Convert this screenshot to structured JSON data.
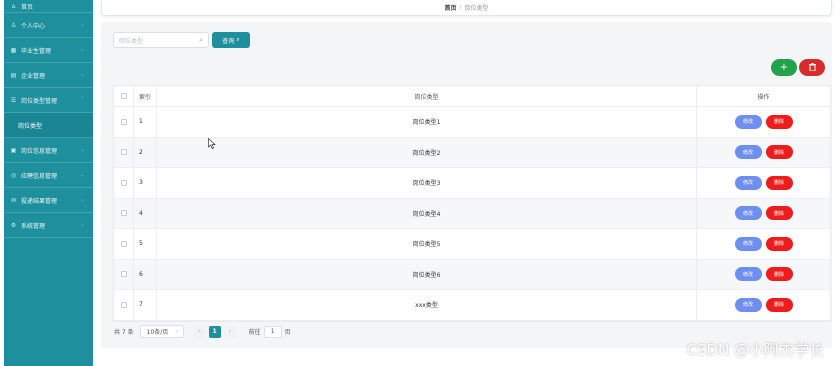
{
  "breadcrumb": {
    "home": "首页",
    "separator": "/",
    "current": "岗位类型"
  },
  "sidebar": {
    "items": [
      {
        "label": "首页",
        "icon": "home-icon",
        "glyph": "⌂"
      },
      {
        "label": "个人中心",
        "icon": "user-icon",
        "glyph": "♙"
      },
      {
        "label": "毕业生管理",
        "icon": "grid-icon",
        "glyph": "▦"
      },
      {
        "label": "企业管理",
        "icon": "building-icon",
        "glyph": "▤"
      },
      {
        "label": "岗位类型管理",
        "icon": "list-icon",
        "glyph": "☰"
      },
      {
        "label": "岗位类型",
        "icon": "",
        "glyph": ""
      },
      {
        "label": "岗位信息管理",
        "icon": "doc-icon",
        "glyph": "▣"
      },
      {
        "label": "应聘信息管理",
        "icon": "pin-icon",
        "glyph": "◎"
      },
      {
        "label": "投递结果管理",
        "icon": "mail-icon",
        "glyph": "✉"
      },
      {
        "label": "系统管理",
        "icon": "gear-icon",
        "glyph": "⚙"
      }
    ]
  },
  "search": {
    "placeholder": "岗位类型",
    "button_label": "查询"
  },
  "actions": {
    "add_glyph": "+",
    "delete_glyph": "🗑"
  },
  "table": {
    "headers": {
      "index": "索引",
      "name": "岗位类型",
      "ops": "操作"
    },
    "edit_label": "修改",
    "delete_label": "删除",
    "rows": [
      {
        "index": "1",
        "name": "岗位类型1"
      },
      {
        "index": "2",
        "name": "岗位类型2"
      },
      {
        "index": "3",
        "name": "岗位类型3"
      },
      {
        "index": "4",
        "name": "岗位类型4"
      },
      {
        "index": "5",
        "name": "岗位类型5"
      },
      {
        "index": "6",
        "name": "岗位类型6"
      },
      {
        "index": "7",
        "name": "xxx类型"
      }
    ]
  },
  "pagination": {
    "total": "共 7 条",
    "page_size": "10条/页",
    "current_page": "1",
    "goto_label": "前往",
    "goto_value": "1",
    "page_unit": "页"
  },
  "watermark": "CSDN @小阿杰学长",
  "colors": {
    "accent": "#1e8f9c",
    "add": "#22a24a",
    "delete": "#d82b2b",
    "edit": "#6e8ff0"
  }
}
